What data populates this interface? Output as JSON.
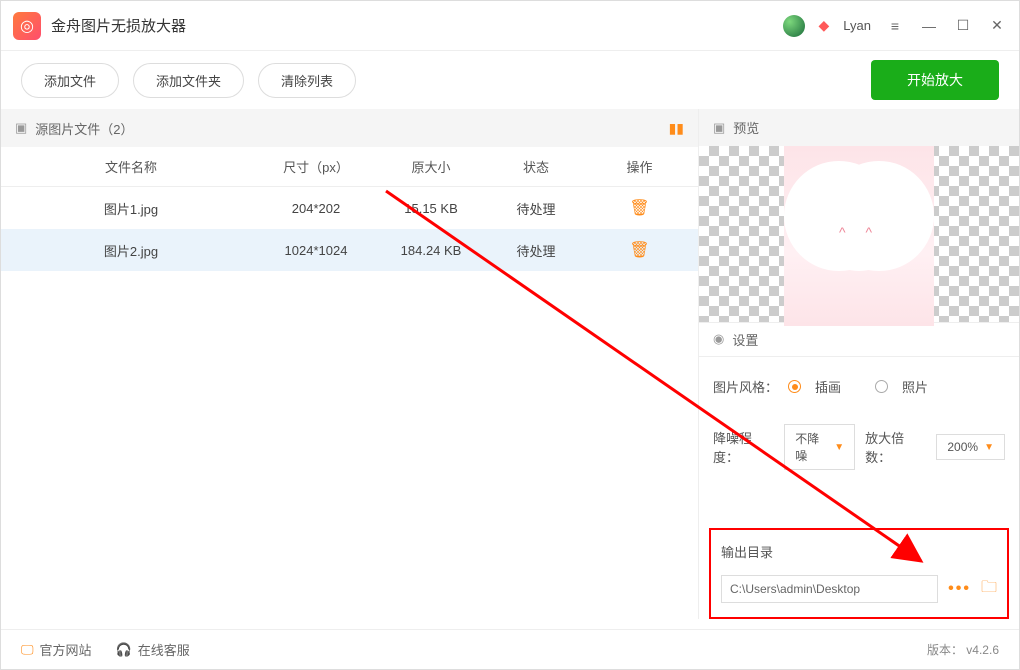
{
  "titlebar": {
    "app_title": "金舟图片无损放大器",
    "username": "Lyan"
  },
  "toolbar": {
    "add_file": "添加文件",
    "add_folder": "添加文件夹",
    "clear_list": "清除列表",
    "start": "开始放大"
  },
  "left": {
    "source_header": "源图片文件（2）",
    "columns": {
      "name": "文件名称",
      "size": "尺寸（px）",
      "orig": "原大小",
      "status": "状态",
      "action": "操作"
    },
    "rows": [
      {
        "name": "图片1.jpg",
        "size": "204*202",
        "orig": "15.15 KB",
        "status": "待处理",
        "selected": false
      },
      {
        "name": "图片2.jpg",
        "size": "1024*1024",
        "orig": "184.24 KB",
        "status": "待处理",
        "selected": true
      }
    ]
  },
  "right": {
    "preview_label": "预览",
    "settings_label": "设置",
    "style_label": "图片风格：",
    "style_illustration": "插画",
    "style_photo": "照片",
    "denoise_label": "降噪程度：",
    "denoise_value": "不降噪",
    "zoom_label": "放大倍数：",
    "zoom_value": "200%",
    "output_label": "输出目录",
    "output_path": "C:\\Users\\admin\\Desktop"
  },
  "footer": {
    "website": "官方网站",
    "support": "在线客服",
    "version": "版本： v4.2.6"
  }
}
